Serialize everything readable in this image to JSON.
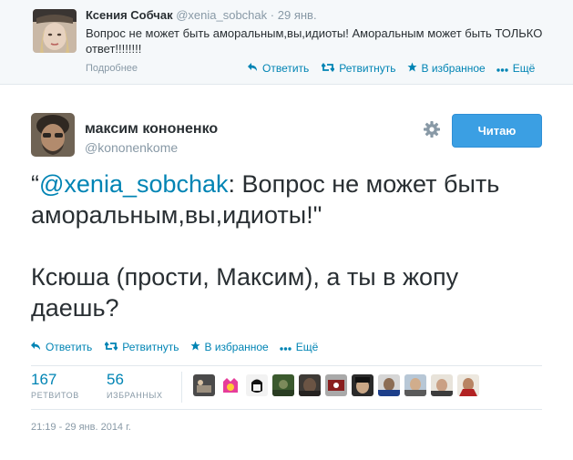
{
  "parent_tweet": {
    "fullname": "Ксения Собчак",
    "screen_name": "@xenia_sobchak",
    "dot": "·",
    "time": "29 янв.",
    "text": "Вопрос не может быть аморальным,вы,идиоты! Аморальным может быть ТОЛЬКО ответ!!!!!!!!",
    "details_link": "Подробнее",
    "actions": {
      "reply": "Ответить",
      "retweet": "Ретвитнуть",
      "favorite": "В избранное",
      "more": "Ещё"
    }
  },
  "main_tweet": {
    "fullname": "максим кононенко",
    "screen_name": "@kononenkome",
    "follow_button": "Читаю",
    "quote_open": "“",
    "mention": "@xenia_sobchak",
    "text_part1": ": Вопрос не может быть аморальным,вы,идиоты!\"",
    "text_part2": "Ксюша (прости, Максим), а ты в жопу даешь?",
    "actions": {
      "reply": "Ответить",
      "retweet": "Ретвитнуть",
      "favorite": "В избранное",
      "more": "Ещё"
    },
    "stats": {
      "retweets_count": "167",
      "retweets_label": "РЕТВИТОВ",
      "favorites_count": "56",
      "favorites_label": "ИЗБРАННЫХ"
    },
    "timestamp": "21:19 - 29 янв. 2014 г."
  },
  "colors": {
    "link": "#0084b4",
    "muted": "#8899a6",
    "text": "#292f33",
    "follow_button_bg": "#3b9fe3",
    "parent_bg": "#f5f8fa"
  },
  "icons": {
    "reply": "reply-arrow-icon",
    "retweet": "retweet-icon",
    "favorite": "star-icon",
    "more": "ellipsis-icon",
    "settings": "gear-icon"
  }
}
